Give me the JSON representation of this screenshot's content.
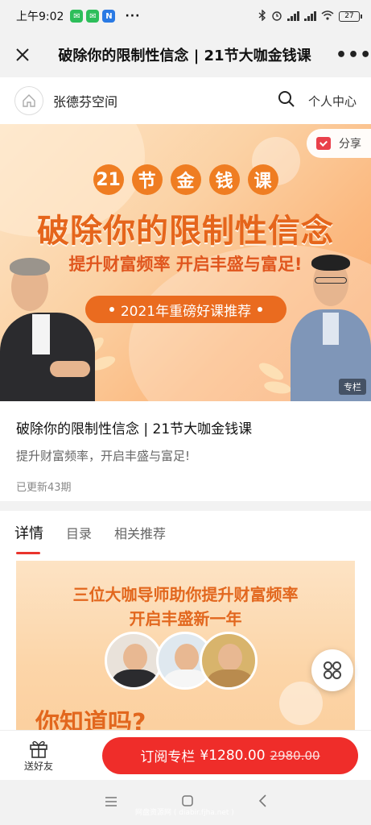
{
  "status": {
    "time": "上午9:02",
    "battery": "27",
    "more": "···"
  },
  "titlebar": {
    "title": "破除你的限制性信念 | 21节大咖金钱课",
    "more": "•••"
  },
  "shop": {
    "name": "张德芬空间",
    "personal_center": "个人中心"
  },
  "banner": {
    "share": "分享",
    "number": "21",
    "chars": [
      "节",
      "金",
      "钱",
      "课"
    ],
    "headline": "破除你的限制性信念",
    "slogan": "提升财富频率  开启丰盛与富足!",
    "pill": "2021年重磅好课推荐",
    "tag": "专栏"
  },
  "course": {
    "title": "破除你的限制性信念 | 21节大咖金钱课",
    "subtitle": "提升财富频率，开启丰盛与富足!",
    "updated": "已更新43期"
  },
  "tabs": [
    "详情",
    "目录",
    "相关推荐"
  ],
  "promo": {
    "line1": "三位大咖导师助你提升财富频率",
    "line2": "开启丰盛新一年",
    "know": "你知道吗?"
  },
  "bottom": {
    "gift_label": "送好友",
    "subscribe_label": "订阅专栏",
    "price": "¥1280.00",
    "original_price": "2980.00"
  },
  "watermark": "网盘资源网 ( diabir.fjha.net )"
}
